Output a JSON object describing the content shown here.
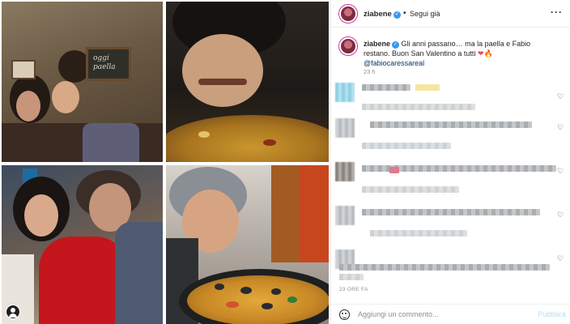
{
  "post": {
    "username": "ziabene",
    "verified_icon": "verified-badge-icon",
    "separator": "•",
    "follow_label": "Segui già",
    "more_icon": "more-options-icon",
    "more_label": "···"
  },
  "caption": {
    "username": "ziabene",
    "text": "Gli anni passano… ma la paella e Fabio restano. Buon San Valentino a tutti",
    "emoji": "❤🔥",
    "mention": "@fabiocaressareal",
    "time": "23 h"
  },
  "collage": {
    "board_text": "oggi paella",
    "tag_icon": "user-tag-icon"
  },
  "comments": {
    "like_icon": "heart-outline-icon",
    "like_glyph": "♡"
  },
  "footer": {
    "time_label": "23 ORE FA",
    "comment_placeholder": "Aggiungi un commento...",
    "publish_label": "Pubblica",
    "emoji_icon": "emoji-icon"
  },
  "colors": {
    "link": "#00376b",
    "verified": "#3897f0",
    "publish_disabled": "#b2dffc",
    "muted": "#8e8e8e"
  }
}
